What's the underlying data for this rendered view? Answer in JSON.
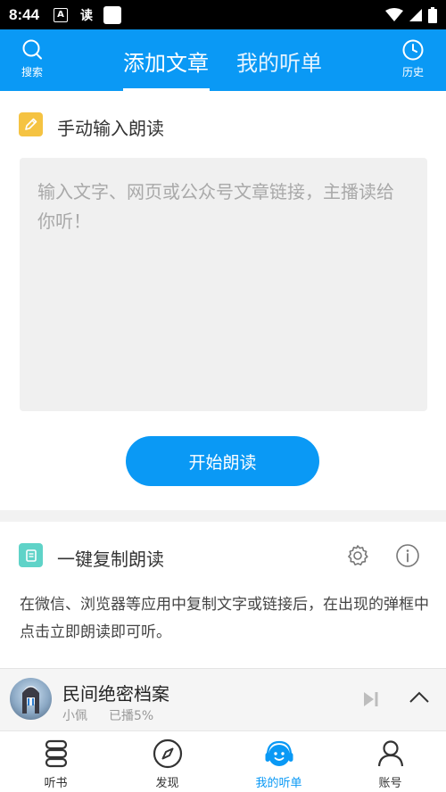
{
  "status_bar": {
    "time": "8:44",
    "app_glyph": "A",
    "du_glyph": "读"
  },
  "header": {
    "search_label": "搜索",
    "history_label": "历史",
    "tabs": [
      {
        "label": "添加文章",
        "active": true
      },
      {
        "label": "我的听单",
        "active": false
      }
    ]
  },
  "manual_section": {
    "title": "手动输入朗读",
    "placeholder": "输入文字、网页或公众号文章链接，主播读给你听！",
    "start_button": "开始朗读"
  },
  "copy_section": {
    "title": "一键复制朗读",
    "description": "在微信、浏览器等应用中复制文字或链接后，在出现的弹框中点击立即朗读即可听。"
  },
  "player": {
    "title": "民间绝密档案",
    "author": "小佩",
    "progress": "已播5%"
  },
  "bottom_nav": [
    {
      "label": "听书",
      "icon": "stack-icon",
      "active": false
    },
    {
      "label": "发现",
      "icon": "compass-icon",
      "active": false
    },
    {
      "label": "我的听单",
      "icon": "headphone-face-icon",
      "active": true
    },
    {
      "label": "账号",
      "icon": "person-icon",
      "active": false
    }
  ],
  "colors": {
    "accent": "#0a99f5",
    "pencil_badge": "#f5c342",
    "copy_badge": "#5fd3c8"
  }
}
